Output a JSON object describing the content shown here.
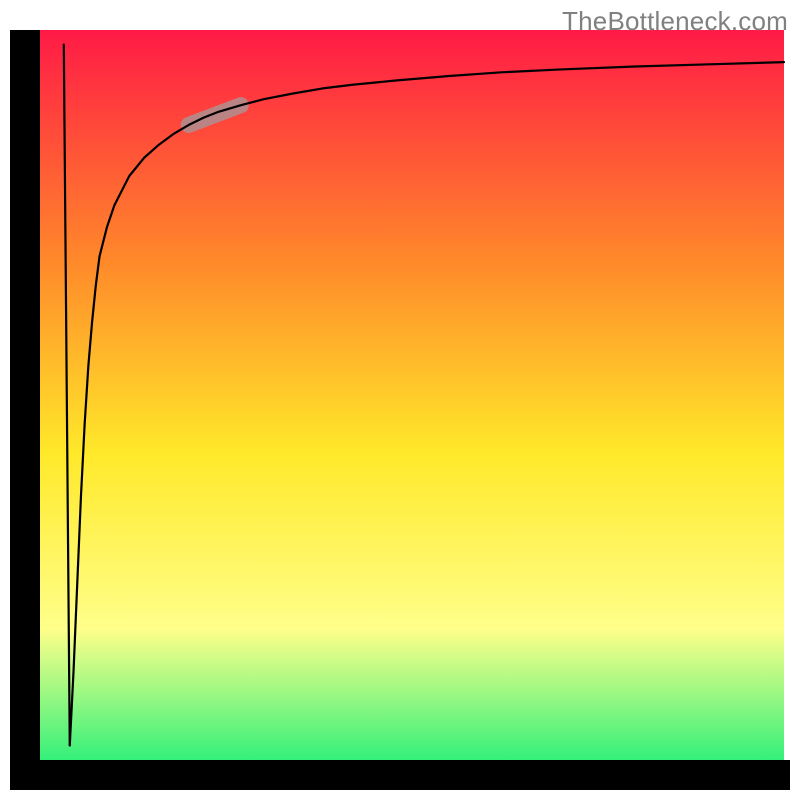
{
  "attribution": "TheBottleneck.com",
  "chart_data": {
    "type": "line",
    "title": "",
    "xlabel": "",
    "ylabel": "",
    "xlim": [
      0,
      100
    ],
    "ylim": [
      0,
      100
    ],
    "grid": false,
    "legend": false,
    "background_gradient": {
      "top_color": "#ff1a46",
      "mid_upper_color": "#ff8a2a",
      "mid_color": "#ffe92a",
      "mid_lower_color": "#ffff8a",
      "bottom_color": "#34f07a"
    },
    "series": [
      {
        "name": "bottleneck-curve",
        "stroke": "#000000",
        "stroke_width": 2.2,
        "x": [
          4,
          4.5,
          5,
          5.5,
          6,
          6.5,
          7,
          7.5,
          8,
          9,
          10,
          12,
          14,
          16,
          18,
          20,
          22,
          24,
          27,
          30,
          34,
          38,
          42,
          48,
          55,
          62,
          70,
          80,
          90,
          100
        ],
        "y": [
          2,
          12,
          24,
          36,
          46,
          54,
          60,
          65,
          69,
          73,
          76,
          80,
          82.5,
          84.3,
          85.8,
          87,
          88,
          88.8,
          89.7,
          90.5,
          91.3,
          92,
          92.5,
          93.1,
          93.7,
          94.2,
          94.6,
          95,
          95.3,
          95.6
        ]
      },
      {
        "name": "initial-drop",
        "stroke": "#000000",
        "stroke_width": 2.2,
        "x": [
          3.2,
          4
        ],
        "y": [
          98,
          2
        ]
      }
    ],
    "highlight_segment": {
      "name": "highlight-pill",
      "stroke": "#bb8484",
      "stroke_width": 16,
      "linecap": "round",
      "x": [
        20,
        27
      ],
      "y": [
        87,
        89.7
      ]
    },
    "axes": {
      "left_border": {
        "x": 3.2,
        "stroke": "#000000",
        "width": 30
      },
      "bottom_border": {
        "y": 0,
        "stroke": "#000000",
        "width": 30
      }
    }
  }
}
